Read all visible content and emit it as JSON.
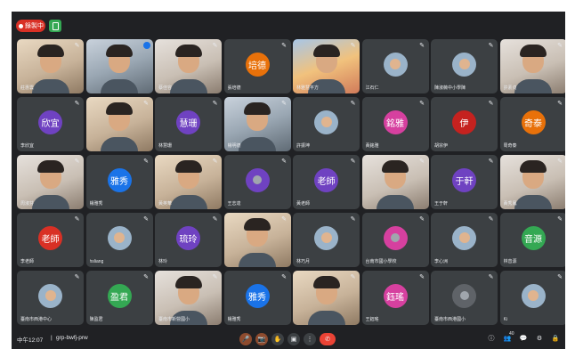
{
  "topbar": {
    "recording_label": "錄製中"
  },
  "tiles": [
    {
      "name": "莊惠雲",
      "type": "video",
      "style": "v3",
      "muted": true
    },
    {
      "name": "",
      "type": "video",
      "style": "v2",
      "muted": false,
      "speaking": true
    },
    {
      "name": "蔡佳容",
      "type": "video",
      "style": "v5",
      "muted": true
    },
    {
      "name": "張培德",
      "type": "avatar",
      "initials": "培德",
      "color": "#e8710a",
      "muted": true
    },
    {
      "name": "林雅慧平方",
      "type": "video",
      "style": "v4",
      "muted": true
    },
    {
      "name": "江石仁",
      "type": "avatar-img",
      "muted": true
    },
    {
      "name": "陳淑薇中小學陳",
      "type": "avatar-img",
      "muted": true
    },
    {
      "name": "許素貞",
      "type": "video",
      "style": "v5",
      "muted": true
    },
    {
      "name": "李欣宜",
      "type": "avatar",
      "initials": "欣宜",
      "color": "#6f42c1",
      "muted": true
    },
    {
      "name": "",
      "type": "video",
      "style": "v3",
      "muted": true
    },
    {
      "name": "林慧珊",
      "type": "avatar",
      "initials": "慧珊",
      "color": "#6f42c1",
      "muted": true
    },
    {
      "name": "楊明德",
      "type": "video",
      "style": "v2",
      "muted": true
    },
    {
      "name": "許振坤",
      "type": "avatar-img",
      "muted": true
    },
    {
      "name": "黃銘雅",
      "type": "avatar",
      "initials": "銘雅",
      "color": "#d6409f",
      "muted": true
    },
    {
      "name": "胡宗伊",
      "type": "avatar",
      "initials": "伊",
      "color": "#c5221f",
      "muted": true
    },
    {
      "name": "周奇泰",
      "type": "avatar",
      "initials": "奇泰",
      "color": "#e8710a",
      "muted": true
    },
    {
      "name": "周淑芬",
      "type": "video",
      "style": "v5",
      "muted": true
    },
    {
      "name": "楊雅秀",
      "type": "avatar",
      "initials": "雅秀",
      "color": "#1a73e8",
      "muted": true
    },
    {
      "name": "黃英華",
      "type": "video",
      "style": "v3",
      "muted": true
    },
    {
      "name": "王志達",
      "type": "avatar-person",
      "color": "#6f42c1",
      "muted": true
    },
    {
      "name": "黃老師",
      "type": "avatar",
      "initials": "老師",
      "color": "#6f42c1",
      "muted": true
    },
    {
      "name": "",
      "type": "video",
      "style": "v5",
      "muted": true
    },
    {
      "name": "王于軒",
      "type": "avatar",
      "initials": "于軒",
      "color": "#6f42c1",
      "muted": true
    },
    {
      "name": "黃秀鳳",
      "type": "video",
      "style": "v5",
      "muted": true
    },
    {
      "name": "李老師",
      "type": "avatar",
      "initials": "老師",
      "color": "#d93025",
      "muted": true
    },
    {
      "name": "hsliang",
      "type": "avatar-img",
      "muted": true
    },
    {
      "name": "林玲",
      "type": "avatar",
      "initials": "琉玲",
      "color": "#6f42c1",
      "muted": true
    },
    {
      "name": "",
      "type": "video",
      "style": "v3",
      "muted": true
    },
    {
      "name": "林巧月",
      "type": "avatar-img",
      "muted": true
    },
    {
      "name": "台南市國小學校",
      "type": "avatar-person",
      "color": "#d6409f",
      "muted": true
    },
    {
      "name": "李心洲",
      "type": "avatar-img",
      "muted": true
    },
    {
      "name": "林音源",
      "type": "avatar",
      "initials": "音源",
      "color": "#34a853",
      "muted": true
    },
    {
      "name": "臺南市西港中心",
      "type": "avatar-img",
      "muted": true
    },
    {
      "name": "陳盈君",
      "type": "avatar",
      "initials": "盈君",
      "color": "#34a853",
      "muted": true
    },
    {
      "name": "臺南市新營國小",
      "type": "video",
      "style": "v5",
      "muted": true
    },
    {
      "name": "楊雅秀",
      "type": "avatar",
      "initials": "雅秀",
      "color": "#1a73e8",
      "muted": true
    },
    {
      "name": "",
      "type": "video",
      "style": "v3",
      "muted": true
    },
    {
      "name": "王鈺瑤",
      "type": "avatar",
      "initials": "鈺瑤",
      "color": "#d6409f",
      "muted": true
    },
    {
      "name": "臺南市西港國小",
      "type": "avatar-person",
      "color": "#5f6368",
      "muted": true
    },
    {
      "name": "Ki",
      "type": "avatar-img",
      "muted": true
    }
  ],
  "bottombar": {
    "time": "中午12:07",
    "separator": "|",
    "meeting_code": "grp-bwfj-prw",
    "people_count": "40"
  },
  "icons": {
    "mic": "🎤",
    "camera": "📷",
    "hand": "✋",
    "present": "▣",
    "more": "⋮",
    "leave": "✆",
    "info": "ⓘ",
    "people": "👥",
    "chat": "💬",
    "activities": "⚙",
    "lock": "🔒"
  }
}
